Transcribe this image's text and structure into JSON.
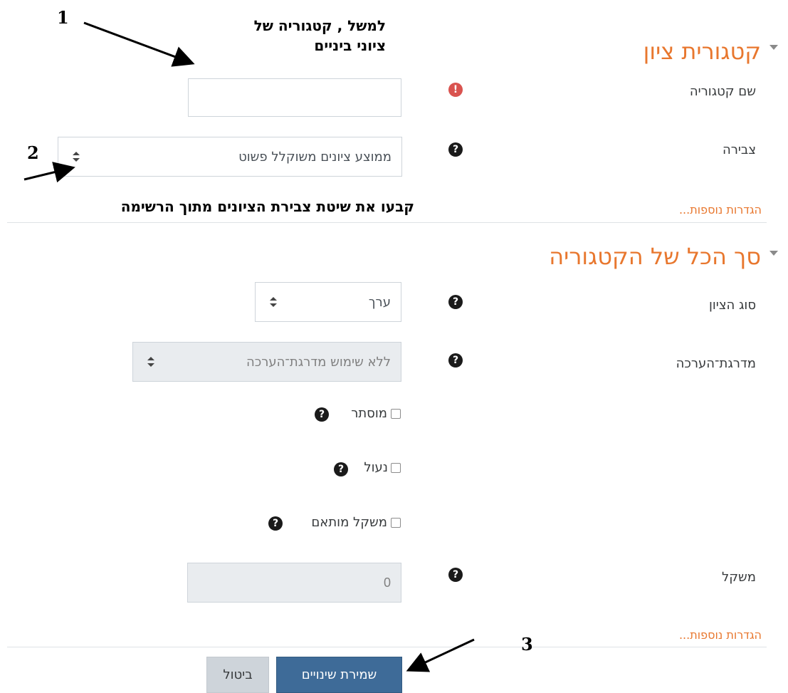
{
  "section_grade_category": {
    "title": "קטגורית ציון",
    "category_name": {
      "label": "שם קטגוריה",
      "value": ""
    },
    "aggregation": {
      "label": "צבירה",
      "value": "ממוצע ציונים משוקלל פשוט"
    },
    "more_settings": "הגדרות נוספות..."
  },
  "section_category_total": {
    "title": "סך הכל של הקטגוריה",
    "grade_type": {
      "label": "סוג הציון",
      "value": "ערך"
    },
    "scale": {
      "label": "מדרגת־הערכה",
      "value": "ללא שימוש מדרגת־הערכה"
    },
    "hidden": {
      "label": "מוסתר"
    },
    "locked": {
      "label": "נעול"
    },
    "weight_adjusted": {
      "label": "משקל מותאם"
    },
    "weight": {
      "label": "משקל",
      "value": "0"
    },
    "more_settings": "הגדרות נוספות..."
  },
  "buttons": {
    "save": "שמירת שינויים",
    "cancel": "ביטול"
  },
  "annotations": {
    "n1": "1",
    "n1_text_line1": "למשל , קטגוריה של",
    "n1_text_line2": "ציוני ביניים",
    "n2": "2",
    "n2_text": "קבעו את שיטת צבירת הציונים מתוך הרשימה",
    "n3": "3"
  },
  "colors": {
    "accent": "#e8772e",
    "primary_button": "#3e6b98",
    "error": "#d9534f"
  }
}
